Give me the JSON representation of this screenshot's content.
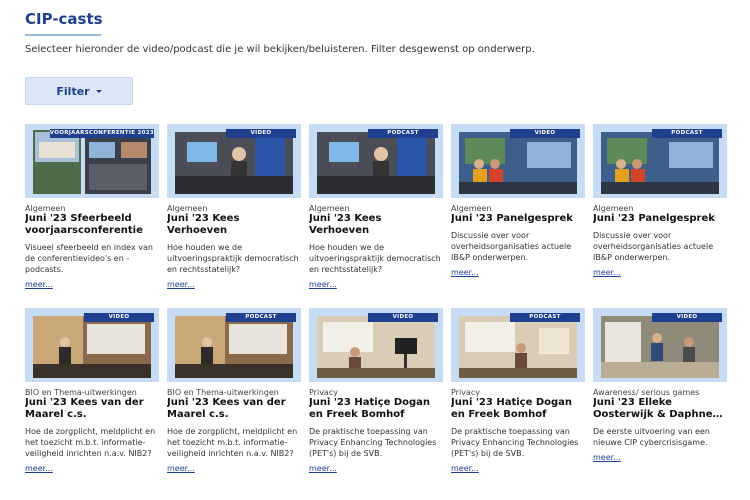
{
  "page": {
    "title": "CIP-casts",
    "intro": "Selecteer hieronder de video/podcast die je wil bekijken/beluisteren. Filter desgewenst op onderwerp.",
    "filter_label": "Filter"
  },
  "colors": {
    "brand": "#1f3f8f",
    "thumb_bg": "#c6dbf4",
    "button_bg": "#dbe7f6"
  },
  "cards": [
    {
      "badge": "VOORJAARSCONFERENTIE 2023",
      "category": "Algemeen",
      "title": "Juni '23 Sfeerbeeld voorjaarsconferentie",
      "description": "Visueel sfeerbeeld en index van de conferentievideo's en -podcasts.",
      "more": "meer..."
    },
    {
      "badge": "VIDEO",
      "category": "Algemeen",
      "title": "Juni '23 Kees Verhoeven",
      "description": "Hoe houden we de uitvoeringspraktijk democratisch en rechtsstatelijk?",
      "more": "meer..."
    },
    {
      "badge": "PODCAST",
      "category": "Algemeen",
      "title": "Juni '23 Kees Verhoeven",
      "description": "Hoe houden we de uitvoeringspraktijk democratisch en rechtsstatelijk?",
      "more": "meer..."
    },
    {
      "badge": "VIDEO",
      "category": "Algemeen",
      "title": "Juni '23 Panelgesprek",
      "description": "Discussie over voor overheidsorganisaties actuele IB&P onderwerpen.",
      "more": "meer..."
    },
    {
      "badge": "PODCAST",
      "category": "Algemeen",
      "title": "Juni '23 Panelgesprek",
      "description": "Discussie over voor overheidsorganisaties actuele IB&P onderwerpen.",
      "more": "meer..."
    },
    {
      "badge": "VIDEO",
      "category": "BIO en Thema-uitwerkingen",
      "title": "Juni '23 Kees van der Maarel c.s.",
      "description": "Hoe de zorgplicht, meldplicht en het toezicht m.b.t. informatie-veiligheid inrichten n.a.v. NIB2?",
      "more": "meer..."
    },
    {
      "badge": "PODCAST",
      "category": "BIO en Thema-uitwerkingen",
      "title": "Juni '23 Kees van der Maarel c.s.",
      "description": "Hoe de zorgplicht, meldplicht en het toezicht m.b.t. informatie-veiligheid inrichten n.a.v. NIB2?",
      "more": "meer..."
    },
    {
      "badge": "VIDEO",
      "category": "Privacy",
      "title": "Juni '23 Hatiçe Dogan en Freek Bomhof",
      "description": "De praktische toepassing van Privacy Enhancing Technologies (PET's) bij de SVB.",
      "more": "meer..."
    },
    {
      "badge": "PODCAST",
      "category": "Privacy",
      "title": "Juni '23 Hatiçe Dogan en Freek Bomhof",
      "description": "De praktische toepassing van Privacy Enhancing Technologies (PET's) bij de SVB.",
      "more": "meer..."
    },
    {
      "badge": "VIDEO",
      "category": "Awareness/ serious games",
      "title": "Juni '23 Elleke Oosterwijk & Daphne…",
      "description": "De eerste uitvoering van een nieuwe CIP cybercrisisgame.",
      "more": "meer..."
    }
  ]
}
